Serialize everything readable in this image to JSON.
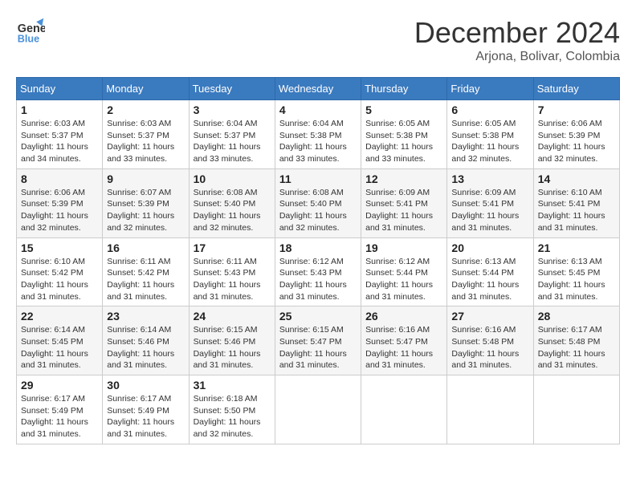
{
  "header": {
    "logo_line1": "General",
    "logo_line2": "Blue",
    "month_year": "December 2024",
    "location": "Arjona, Bolivar, Colombia"
  },
  "weekdays": [
    "Sunday",
    "Monday",
    "Tuesday",
    "Wednesday",
    "Thursday",
    "Friday",
    "Saturday"
  ],
  "weeks": [
    [
      {
        "day": "1",
        "sunrise": "6:03 AM",
        "sunset": "5:37 PM",
        "daylight": "11 hours and 34 minutes."
      },
      {
        "day": "2",
        "sunrise": "6:03 AM",
        "sunset": "5:37 PM",
        "daylight": "11 hours and 33 minutes."
      },
      {
        "day": "3",
        "sunrise": "6:04 AM",
        "sunset": "5:37 PM",
        "daylight": "11 hours and 33 minutes."
      },
      {
        "day": "4",
        "sunrise": "6:04 AM",
        "sunset": "5:38 PM",
        "daylight": "11 hours and 33 minutes."
      },
      {
        "day": "5",
        "sunrise": "6:05 AM",
        "sunset": "5:38 PM",
        "daylight": "11 hours and 33 minutes."
      },
      {
        "day": "6",
        "sunrise": "6:05 AM",
        "sunset": "5:38 PM",
        "daylight": "11 hours and 32 minutes."
      },
      {
        "day": "7",
        "sunrise": "6:06 AM",
        "sunset": "5:39 PM",
        "daylight": "11 hours and 32 minutes."
      }
    ],
    [
      {
        "day": "8",
        "sunrise": "6:06 AM",
        "sunset": "5:39 PM",
        "daylight": "11 hours and 32 minutes."
      },
      {
        "day": "9",
        "sunrise": "6:07 AM",
        "sunset": "5:39 PM",
        "daylight": "11 hours and 32 minutes."
      },
      {
        "day": "10",
        "sunrise": "6:08 AM",
        "sunset": "5:40 PM",
        "daylight": "11 hours and 32 minutes."
      },
      {
        "day": "11",
        "sunrise": "6:08 AM",
        "sunset": "5:40 PM",
        "daylight": "11 hours and 32 minutes."
      },
      {
        "day": "12",
        "sunrise": "6:09 AM",
        "sunset": "5:41 PM",
        "daylight": "11 hours and 31 minutes."
      },
      {
        "day": "13",
        "sunrise": "6:09 AM",
        "sunset": "5:41 PM",
        "daylight": "11 hours and 31 minutes."
      },
      {
        "day": "14",
        "sunrise": "6:10 AM",
        "sunset": "5:41 PM",
        "daylight": "11 hours and 31 minutes."
      }
    ],
    [
      {
        "day": "15",
        "sunrise": "6:10 AM",
        "sunset": "5:42 PM",
        "daylight": "11 hours and 31 minutes."
      },
      {
        "day": "16",
        "sunrise": "6:11 AM",
        "sunset": "5:42 PM",
        "daylight": "11 hours and 31 minutes."
      },
      {
        "day": "17",
        "sunrise": "6:11 AM",
        "sunset": "5:43 PM",
        "daylight": "11 hours and 31 minutes."
      },
      {
        "day": "18",
        "sunrise": "6:12 AM",
        "sunset": "5:43 PM",
        "daylight": "11 hours and 31 minutes."
      },
      {
        "day": "19",
        "sunrise": "6:12 AM",
        "sunset": "5:44 PM",
        "daylight": "11 hours and 31 minutes."
      },
      {
        "day": "20",
        "sunrise": "6:13 AM",
        "sunset": "5:44 PM",
        "daylight": "11 hours and 31 minutes."
      },
      {
        "day": "21",
        "sunrise": "6:13 AM",
        "sunset": "5:45 PM",
        "daylight": "11 hours and 31 minutes."
      }
    ],
    [
      {
        "day": "22",
        "sunrise": "6:14 AM",
        "sunset": "5:45 PM",
        "daylight": "11 hours and 31 minutes."
      },
      {
        "day": "23",
        "sunrise": "6:14 AM",
        "sunset": "5:46 PM",
        "daylight": "11 hours and 31 minutes."
      },
      {
        "day": "24",
        "sunrise": "6:15 AM",
        "sunset": "5:46 PM",
        "daylight": "11 hours and 31 minutes."
      },
      {
        "day": "25",
        "sunrise": "6:15 AM",
        "sunset": "5:47 PM",
        "daylight": "11 hours and 31 minutes."
      },
      {
        "day": "26",
        "sunrise": "6:16 AM",
        "sunset": "5:47 PM",
        "daylight": "11 hours and 31 minutes."
      },
      {
        "day": "27",
        "sunrise": "6:16 AM",
        "sunset": "5:48 PM",
        "daylight": "11 hours and 31 minutes."
      },
      {
        "day": "28",
        "sunrise": "6:17 AM",
        "sunset": "5:48 PM",
        "daylight": "11 hours and 31 minutes."
      }
    ],
    [
      {
        "day": "29",
        "sunrise": "6:17 AM",
        "sunset": "5:49 PM",
        "daylight": "11 hours and 31 minutes."
      },
      {
        "day": "30",
        "sunrise": "6:17 AM",
        "sunset": "5:49 PM",
        "daylight": "11 hours and 31 minutes."
      },
      {
        "day": "31",
        "sunrise": "6:18 AM",
        "sunset": "5:50 PM",
        "daylight": "11 hours and 32 minutes."
      },
      null,
      null,
      null,
      null
    ]
  ]
}
